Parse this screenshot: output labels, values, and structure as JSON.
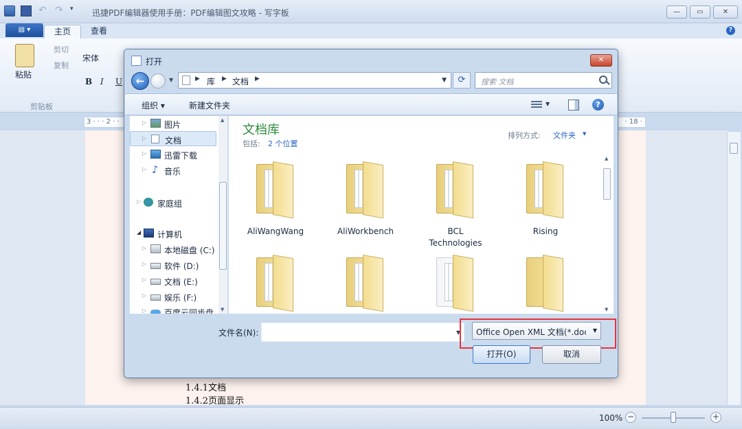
{
  "wordpad": {
    "title": "迅捷PDF编辑器使用手册：PDF编辑图文攻略 - 写字板",
    "tabs": [
      "主页",
      "查看"
    ],
    "clipboard": {
      "paste": "粘贴",
      "cut": "剪切",
      "copy": "复制",
      "group": "剪贴板"
    },
    "font_name": "宋体",
    "format_buttons": {
      "bold": "B",
      "italic": "I",
      "underline": "U"
    },
    "ruler": {
      "left": "3 · · · 2 · ·",
      "right": "· 18 ·"
    },
    "document_lines": [
      "1.4.1文档",
      "1.4.2页面显示"
    ],
    "zoom": "100%"
  },
  "dialog": {
    "title": "打开",
    "address": {
      "crumbs": [
        "库",
        "文档"
      ]
    },
    "search_placeholder": "搜索 文档",
    "toolbar": {
      "organize": "组织 ▾",
      "new_folder": "新建文件夹"
    },
    "nav_items": [
      {
        "label": "图片",
        "icon": "pictures-icon"
      },
      {
        "label": "文档",
        "icon": "documents-icon",
        "selected": true
      },
      {
        "label": "迅雷下载",
        "icon": "download-icon"
      },
      {
        "label": "音乐",
        "icon": "music-icon"
      },
      {
        "label": "家庭组",
        "icon": "homegroup-icon"
      },
      {
        "label": "计算机",
        "icon": "computer-icon"
      },
      {
        "label": "本地磁盘 (C:)",
        "icon": "drive-icon"
      },
      {
        "label": "软件 (D:)",
        "icon": "drive-icon"
      },
      {
        "label": "文档 (E:)",
        "icon": "drive-icon"
      },
      {
        "label": "娱乐 (F:)",
        "icon": "drive-icon"
      },
      {
        "label": "百度云同步盘",
        "icon": "cloud-icon"
      }
    ],
    "library": {
      "title": "文档库",
      "includes_label": "包括:",
      "locations": "2 个位置",
      "arrange_label": "排列方式:",
      "arrange_value": "文件夹"
    },
    "folders": [
      "AliWangWang",
      "AliWorkbench",
      "BCL\nTechnologies",
      "Rising",
      "",
      "",
      "",
      ""
    ],
    "filename_label": "文件名(N):",
    "filename_value": "",
    "file_type": "Office Open XML 文档(*.docx)",
    "open_button": "打开(O)",
    "cancel_button": "取消"
  }
}
